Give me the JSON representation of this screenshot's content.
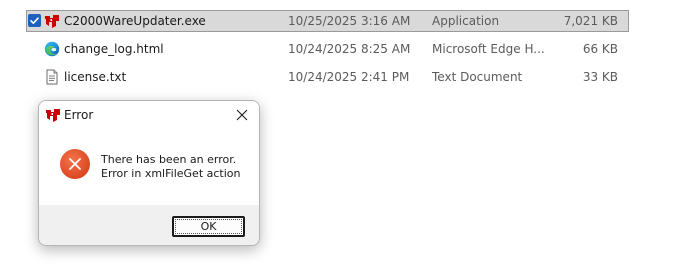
{
  "files": [
    {
      "name": "C2000WareUpdater.exe",
      "date_modified": "10/25/2025 3:16 AM",
      "type": "Application",
      "size": "7,021 KB",
      "icon": "ti-logo-icon",
      "selected": true,
      "checked": true
    },
    {
      "name": "change_log.html",
      "date_modified": "10/24/2025 8:25 AM",
      "type": "Microsoft Edge H...",
      "size": "66 KB",
      "icon": "edge-icon",
      "selected": false
    },
    {
      "name": "license.txt",
      "date_modified": "10/24/2025 2:41 PM",
      "type": "Text Document",
      "size": "33 KB",
      "icon": "text-document-icon",
      "selected": false
    }
  ],
  "dialog": {
    "title": "Error",
    "icon": "ti-logo-icon",
    "message_line1": "There has been an error.",
    "message_line2": "Error in xmlFileGet action",
    "ok_label": "OK",
    "error_icon_color": "#e0502a"
  },
  "colors": {
    "selection_bg": "#d9d9d9",
    "checkbox": "#1f5fbf",
    "ti_red": "#cc0000"
  }
}
